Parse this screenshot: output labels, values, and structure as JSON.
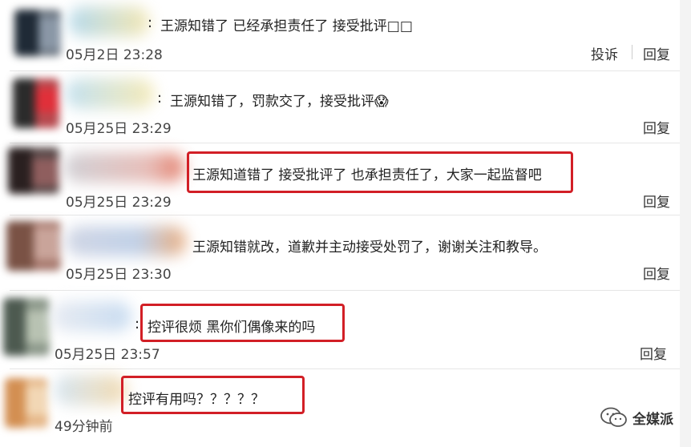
{
  "comments": [
    {
      "text": "王源知错了 已经承担责任了 接受批评□□",
      "time": "05月2日 23:28",
      "actions": [
        "投诉",
        "回复"
      ]
    },
    {
      "text": "王源知错了，罚款交了，接受批评😱",
      "time": "05月25日 23:29",
      "actions": [
        "回复"
      ]
    },
    {
      "text": "王源知道错了 接受批评了 也承担责任了，大家一起监督吧",
      "time": "05月25日 23:29",
      "actions": [
        "回复"
      ]
    },
    {
      "text": "王源知错就改，道歉并主动接受处罚了，谢谢关注和教导。",
      "time": "05月25日 23:30",
      "actions": [
        "回复"
      ]
    },
    {
      "text": "控评很烦 黑你们偶像来的吗",
      "time": "05月25日 23:57",
      "actions": [
        "回复"
      ]
    },
    {
      "text": "控评有用吗？？？？？",
      "time": "49分钟前",
      "actions": []
    }
  ],
  "watermark": {
    "label": "全媒派",
    "icon": "wechat-icon"
  },
  "colors": {
    "highlight": "#d21f26"
  }
}
